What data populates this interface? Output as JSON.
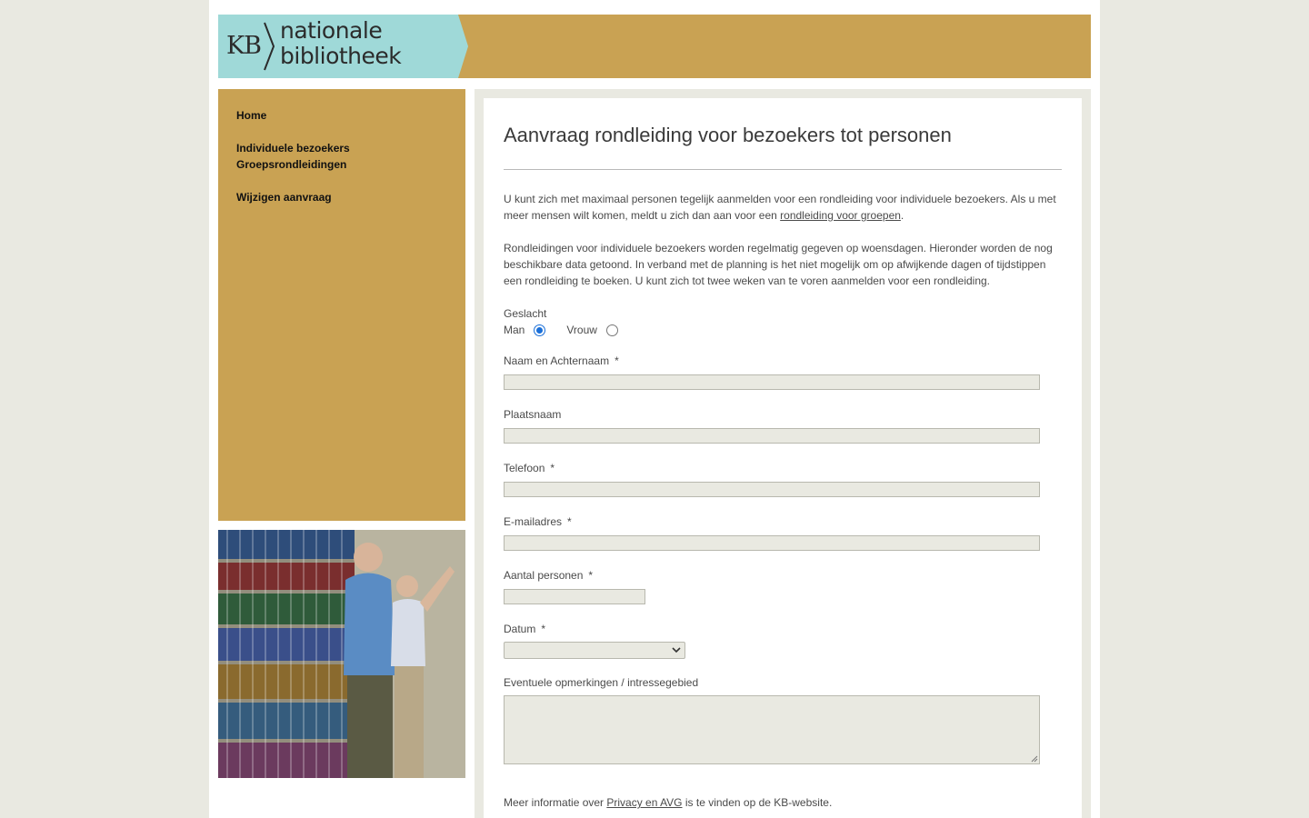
{
  "brand": {
    "kb": "KB",
    "line1": "nationale",
    "line2": "bibliotheek"
  },
  "nav": {
    "items": [
      {
        "label": "Home"
      },
      {
        "label": "Individuele bezoekers"
      },
      {
        "label": "Groepsrondleidingen"
      },
      {
        "label": "Wijzigen aanvraag"
      }
    ]
  },
  "main": {
    "title": "Aanvraag rondleiding voor bezoekers tot personen",
    "intro_before_link": "U kunt zich met maximaal personen tegelijk aanmelden voor een rondleiding voor individuele bezoekers. Als u met meer mensen wilt komen, meldt u zich dan aan voor een ",
    "intro_link": "rondleiding voor groepen",
    "intro_after_link": ".",
    "info": "Rondleidingen voor individuele bezoekers worden regelmatig gegeven op woensdagen. Hieronder worden de nog beschikbare data getoond. In verband met de planning is het niet mogelijk om op afwijkende dagen of tijdstippen een rondleiding te boeken. U kunt zich tot twee weken van te voren aanmelden voor een rondleiding."
  },
  "form": {
    "gender": {
      "label": "Geslacht",
      "options": [
        {
          "label": "Man",
          "selected": true
        },
        {
          "label": "Vrouw",
          "selected": false
        }
      ]
    },
    "name_label": "Naam en Achternaam",
    "city_label": "Plaatsnaam",
    "phone_label": "Telefoon",
    "email_label": "E-mailadres",
    "persons_label": "Aantal personen",
    "date_label": "Datum",
    "remarks_label": "Eventuele opmerkingen / intressegebied",
    "required_mark": "*",
    "date_value": "",
    "name_value": "",
    "city_value": "",
    "phone_value": "",
    "email_value": "",
    "persons_value": "",
    "remarks_value": ""
  },
  "footer": {
    "before_link": "Meer informatie over ",
    "link": "Privacy en AVG",
    "after_link": " is te vinden op de KB-website."
  },
  "colors": {
    "gold": "#c9a253",
    "teal": "#9fd9d8",
    "field_bg": "#e9e9e1",
    "radio_selected": "#1a6fd8"
  }
}
